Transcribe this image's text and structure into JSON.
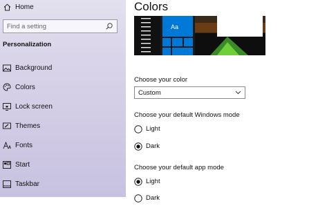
{
  "sidebar": {
    "home_label": "Home",
    "search_placeholder": "Find a setting",
    "section_title": "Personalization",
    "items": [
      {
        "label": "Background",
        "icon": "image-icon"
      },
      {
        "label": "Colors",
        "icon": "palette-icon"
      },
      {
        "label": "Lock screen",
        "icon": "lock-screen-icon"
      },
      {
        "label": "Themes",
        "icon": "brush-icon"
      },
      {
        "label": "Fonts",
        "icon": "font-icon"
      },
      {
        "label": "Start",
        "icon": "start-icon"
      },
      {
        "label": "Taskbar",
        "icon": "taskbar-icon"
      }
    ]
  },
  "main": {
    "title": "Colors",
    "preview_sample_text": "Aa",
    "choose_color_label": "Choose your color",
    "choose_color_value": "Custom",
    "windows_mode_label": "Choose your default Windows mode",
    "windows_mode_options": [
      {
        "label": "Light",
        "selected": false
      },
      {
        "label": "Dark",
        "selected": true
      }
    ],
    "app_mode_label": "Choose your default app mode",
    "app_mode_options": [
      {
        "label": "Light",
        "selected": true
      },
      {
        "label": "Dark",
        "selected": false
      }
    ]
  },
  "colors": {
    "accent": "#0078d7",
    "sidebar_bg": "#d8d3e8"
  }
}
